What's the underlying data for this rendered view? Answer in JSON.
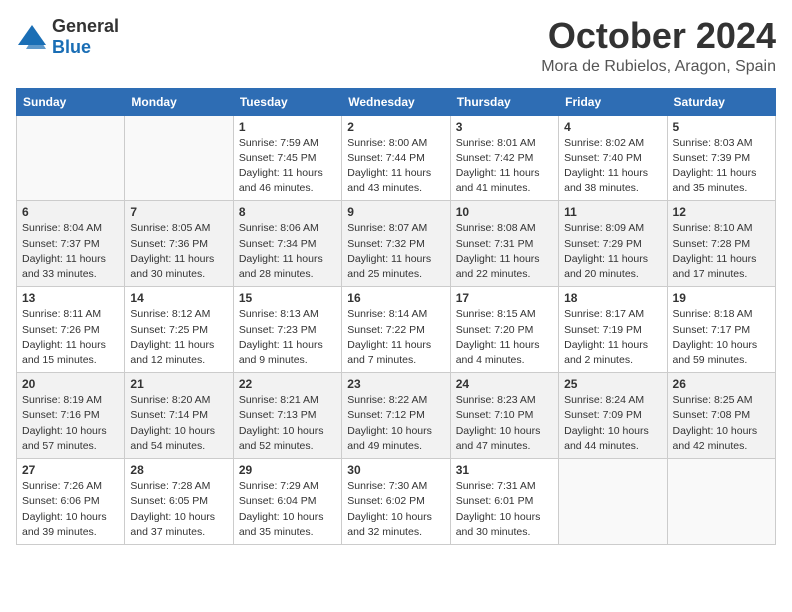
{
  "logo": {
    "general": "General",
    "blue": "Blue"
  },
  "title": "October 2024",
  "location": "Mora de Rubielos, Aragon, Spain",
  "weekdays": [
    "Sunday",
    "Monday",
    "Tuesday",
    "Wednesday",
    "Thursday",
    "Friday",
    "Saturday"
  ],
  "weeks": [
    [
      {
        "day": "",
        "info": ""
      },
      {
        "day": "",
        "info": ""
      },
      {
        "day": "1",
        "info": "Sunrise: 7:59 AM\nSunset: 7:45 PM\nDaylight: 11 hours and 46 minutes."
      },
      {
        "day": "2",
        "info": "Sunrise: 8:00 AM\nSunset: 7:44 PM\nDaylight: 11 hours and 43 minutes."
      },
      {
        "day": "3",
        "info": "Sunrise: 8:01 AM\nSunset: 7:42 PM\nDaylight: 11 hours and 41 minutes."
      },
      {
        "day": "4",
        "info": "Sunrise: 8:02 AM\nSunset: 7:40 PM\nDaylight: 11 hours and 38 minutes."
      },
      {
        "day": "5",
        "info": "Sunrise: 8:03 AM\nSunset: 7:39 PM\nDaylight: 11 hours and 35 minutes."
      }
    ],
    [
      {
        "day": "6",
        "info": "Sunrise: 8:04 AM\nSunset: 7:37 PM\nDaylight: 11 hours and 33 minutes."
      },
      {
        "day": "7",
        "info": "Sunrise: 8:05 AM\nSunset: 7:36 PM\nDaylight: 11 hours and 30 minutes."
      },
      {
        "day": "8",
        "info": "Sunrise: 8:06 AM\nSunset: 7:34 PM\nDaylight: 11 hours and 28 minutes."
      },
      {
        "day": "9",
        "info": "Sunrise: 8:07 AM\nSunset: 7:32 PM\nDaylight: 11 hours and 25 minutes."
      },
      {
        "day": "10",
        "info": "Sunrise: 8:08 AM\nSunset: 7:31 PM\nDaylight: 11 hours and 22 minutes."
      },
      {
        "day": "11",
        "info": "Sunrise: 8:09 AM\nSunset: 7:29 PM\nDaylight: 11 hours and 20 minutes."
      },
      {
        "day": "12",
        "info": "Sunrise: 8:10 AM\nSunset: 7:28 PM\nDaylight: 11 hours and 17 minutes."
      }
    ],
    [
      {
        "day": "13",
        "info": "Sunrise: 8:11 AM\nSunset: 7:26 PM\nDaylight: 11 hours and 15 minutes."
      },
      {
        "day": "14",
        "info": "Sunrise: 8:12 AM\nSunset: 7:25 PM\nDaylight: 11 hours and 12 minutes."
      },
      {
        "day": "15",
        "info": "Sunrise: 8:13 AM\nSunset: 7:23 PM\nDaylight: 11 hours and 9 minutes."
      },
      {
        "day": "16",
        "info": "Sunrise: 8:14 AM\nSunset: 7:22 PM\nDaylight: 11 hours and 7 minutes."
      },
      {
        "day": "17",
        "info": "Sunrise: 8:15 AM\nSunset: 7:20 PM\nDaylight: 11 hours and 4 minutes."
      },
      {
        "day": "18",
        "info": "Sunrise: 8:17 AM\nSunset: 7:19 PM\nDaylight: 11 hours and 2 minutes."
      },
      {
        "day": "19",
        "info": "Sunrise: 8:18 AM\nSunset: 7:17 PM\nDaylight: 10 hours and 59 minutes."
      }
    ],
    [
      {
        "day": "20",
        "info": "Sunrise: 8:19 AM\nSunset: 7:16 PM\nDaylight: 10 hours and 57 minutes."
      },
      {
        "day": "21",
        "info": "Sunrise: 8:20 AM\nSunset: 7:14 PM\nDaylight: 10 hours and 54 minutes."
      },
      {
        "day": "22",
        "info": "Sunrise: 8:21 AM\nSunset: 7:13 PM\nDaylight: 10 hours and 52 minutes."
      },
      {
        "day": "23",
        "info": "Sunrise: 8:22 AM\nSunset: 7:12 PM\nDaylight: 10 hours and 49 minutes."
      },
      {
        "day": "24",
        "info": "Sunrise: 8:23 AM\nSunset: 7:10 PM\nDaylight: 10 hours and 47 minutes."
      },
      {
        "day": "25",
        "info": "Sunrise: 8:24 AM\nSunset: 7:09 PM\nDaylight: 10 hours and 44 minutes."
      },
      {
        "day": "26",
        "info": "Sunrise: 8:25 AM\nSunset: 7:08 PM\nDaylight: 10 hours and 42 minutes."
      }
    ],
    [
      {
        "day": "27",
        "info": "Sunrise: 7:26 AM\nSunset: 6:06 PM\nDaylight: 10 hours and 39 minutes."
      },
      {
        "day": "28",
        "info": "Sunrise: 7:28 AM\nSunset: 6:05 PM\nDaylight: 10 hours and 37 minutes."
      },
      {
        "day": "29",
        "info": "Sunrise: 7:29 AM\nSunset: 6:04 PM\nDaylight: 10 hours and 35 minutes."
      },
      {
        "day": "30",
        "info": "Sunrise: 7:30 AM\nSunset: 6:02 PM\nDaylight: 10 hours and 32 minutes."
      },
      {
        "day": "31",
        "info": "Sunrise: 7:31 AM\nSunset: 6:01 PM\nDaylight: 10 hours and 30 minutes."
      },
      {
        "day": "",
        "info": ""
      },
      {
        "day": "",
        "info": ""
      }
    ]
  ]
}
